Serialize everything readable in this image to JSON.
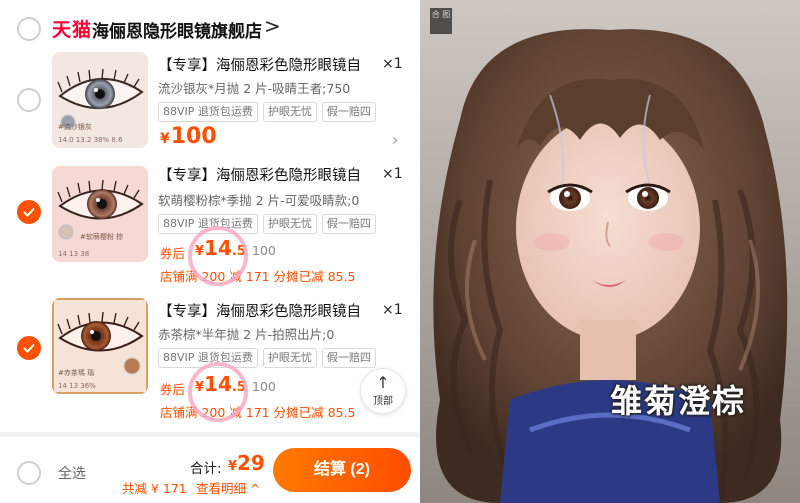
{
  "store": {
    "platform": "天猫",
    "name": "海俪恩隐形眼镜旗舰店",
    "chevron": ">"
  },
  "items": [
    {
      "checked": false,
      "title": "【专享】海俪恩彩色隐形眼镜自",
      "sku": "流沙银灰*月抛 2 片-吸睛王者;750",
      "qty": "×1",
      "tags": [
        "88VIP 退货包运费",
        "护眼无忧",
        "假一赔四"
      ],
      "price_currency": "¥",
      "price": "100",
      "thumb_label": "#流沙银灰",
      "thumb_spec": "14.0 13.2 38% 8.6"
    },
    {
      "checked": true,
      "title": "【专享】海俪恩彩色隐形眼镜自",
      "sku": "软萌樱粉棕*季抛 2 片-可爱吸睛款;0",
      "qty": "×1",
      "tags": [
        "88VIP 退货包运费",
        "护眼无忧",
        "假一赔四"
      ],
      "coupon_label": "券后",
      "coupon_currency": "¥",
      "coupon_int": "14",
      "coupon_dec": ".5",
      "orig_price": "100",
      "promo": "店铺满 200 减 171 分摊已减 85.5",
      "thumb_label": "#软萌樱粉 棕",
      "thumb_spec": "14 13 38"
    },
    {
      "checked": true,
      "title": "【专享】海俪恩彩色隐形眼镜自",
      "sku": "赤茶棕*半年抛 2 片-拍照出片;0",
      "qty": "×1",
      "tags": [
        "88VIP 退货包运费",
        "护眼无忧",
        "假一赔四"
      ],
      "coupon_label": "券后",
      "coupon_currency": "¥",
      "coupon_int": "14",
      "coupon_dec": ".5",
      "orig_price": "100",
      "promo": "店铺满 200 减 171 分摊已减 85.5",
      "thumb_label": "#赤茶瑪 瑙",
      "thumb_spec": "14 13 36%"
    }
  ],
  "top_button": {
    "arrow": "↑",
    "label": "顶部"
  },
  "footer": {
    "select_all": "全选",
    "total_label": "合计:",
    "total_currency": "¥",
    "total_value": "29",
    "saved": "共减 ¥ 171",
    "detail": "查看明细 ^",
    "checkout": "结算 (2)"
  },
  "photo": {
    "caption": "雏菊澄棕",
    "stamp": "合\n图"
  },
  "colors": {
    "accent": "#ff5000",
    "tmall_red": "#ff0036",
    "circle_pink": "#f7aac3"
  }
}
